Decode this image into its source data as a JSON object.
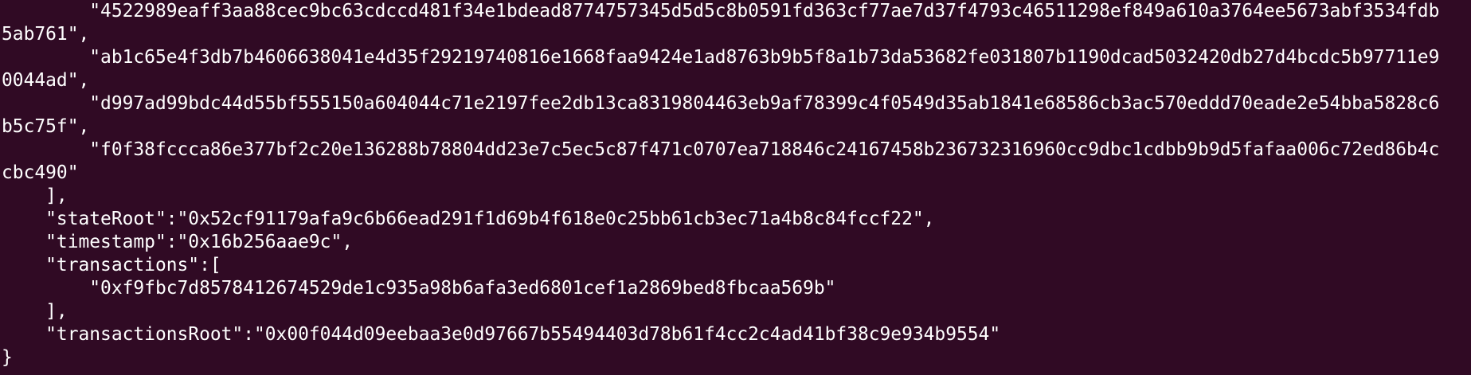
{
  "terminal": {
    "lines": [
      "        \"4522989eaff3aa88cec9bc63cdccd481f34e1bdead8774757345d5d5c8b0591fd363cf77ae7d37f4793c46511298ef849a610a3764ee5673abf3534fdb",
      "5ab761\",",
      "        \"ab1c65e4f3db7b4606638041e4d35f29219740816e1668faa9424e1ad8763b9b5f8a1b73da53682fe031807b1190dcad5032420db27d4bcdc5b97711e9",
      "0044ad\",",
      "        \"d997ad99bdc44d55bf555150a604044c71e2197fee2db13ca8319804463eb9af78399c4f0549d35ab1841e68586cb3ac570eddd70eade2e54bba5828c6",
      "b5c75f\",",
      "        \"f0f38fccca86e377bf2c20e136288b78804dd23e7c5ec5c87f471c0707ea718846c24167458b236732316960cc9dbc1cdbb9b9d5fafaa006c72ed86b4c",
      "cbc490\"",
      "    ],",
      "    \"stateRoot\":\"0x52cf91179afa9c6b66ead291f1d69b4f618e0c25bb61cb3ec71a4b8c84fccf22\",",
      "    \"timestamp\":\"0x16b256aae9c\",",
      "    \"transactions\":[",
      "        \"0xf9fbc7d8578412674529de1c935a98b6afa3ed6801cef1a2869bed8fbcaa569b\"",
      "    ],",
      "    \"transactionsRoot\":\"0x00f044d09eebaa3e0d97667b55494403d78b61f4cc2c4ad41bf38c9e934b9554\"",
      "}"
    ]
  }
}
